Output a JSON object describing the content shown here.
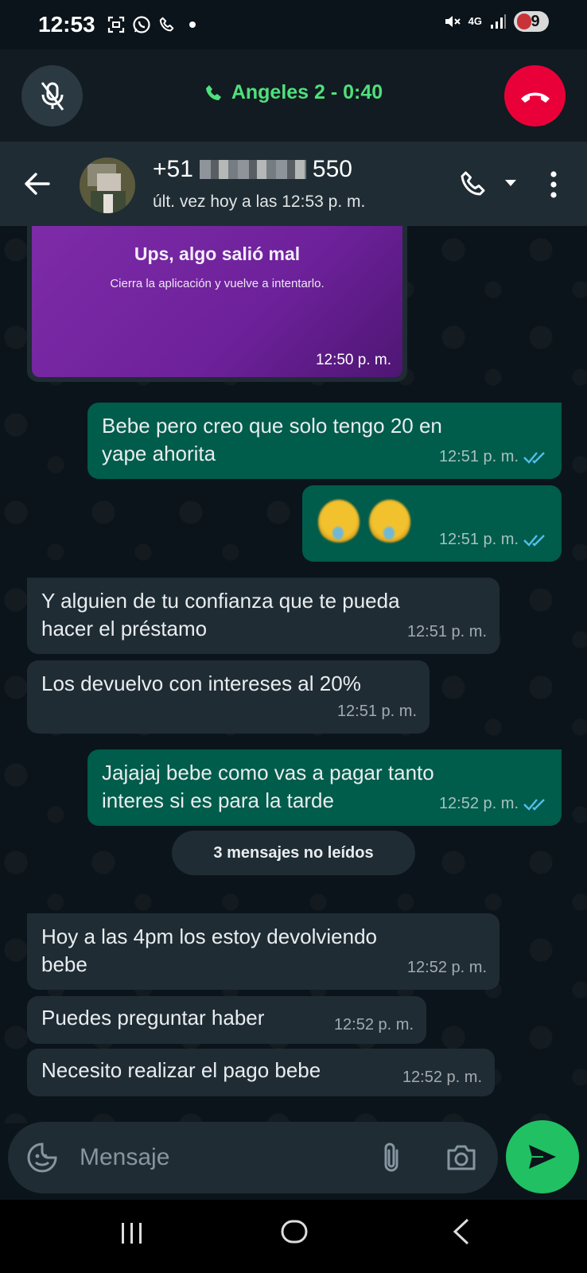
{
  "status_bar": {
    "time": "12:53",
    "network": "4G",
    "battery": "9"
  },
  "call": {
    "label": "Angeles 2 - 0:40"
  },
  "contact": {
    "name_prefix": "+51",
    "name_suffix": "550",
    "status": "últ. vez hoy a las 12:53 p. m."
  },
  "messages": [
    {
      "type": "image",
      "direction": "in",
      "title": "Ups, algo salió mal",
      "subtitle": "Cierra la aplicación y vuelve a intentarlo.",
      "time": "12:50 p. m."
    },
    {
      "type": "text",
      "direction": "out",
      "line1": "Bebe pero creo que solo tengo 20 en",
      "line2": "yape ahorita",
      "time": "12:51 p. m.",
      "read": true
    },
    {
      "type": "emoji",
      "direction": "out",
      "emoji_name": "crying-face-emoji",
      "time": "12:51 p. m.",
      "read": true
    },
    {
      "type": "text",
      "direction": "in",
      "line1": "Y alguien de tu confianza que te pueda",
      "line2": "hacer el préstamo",
      "time": "12:51 p. m."
    },
    {
      "type": "text",
      "direction": "in",
      "line1": "Los devuelvo con intereses al 20%",
      "time": "12:51 p. m."
    },
    {
      "type": "text",
      "direction": "out",
      "line1": "Jajajaj bebe como vas a pagar tanto",
      "line2": "interes si es para la tarde",
      "time": "12:52 p. m.",
      "read": true
    },
    {
      "type": "text",
      "direction": "in",
      "line1": "Hoy a las 4pm  los estoy devolviendo",
      "line2": "bebe",
      "time": "12:52 p. m."
    },
    {
      "type": "text",
      "direction": "in",
      "line1": "Puedes preguntar haber",
      "time": "12:52 p. m."
    },
    {
      "type": "text",
      "direction": "in",
      "line1": "Necesito realizar el pago bebe",
      "time": "12:52 p. m."
    }
  ],
  "unread_divider": "3 mensajes no leídos",
  "composer": {
    "placeholder": "Mensaje"
  },
  "colors": {
    "background": "#0b141a",
    "incoming_bubble": "#1f2c34",
    "outgoing_bubble": "#005c4b",
    "call_green": "#4fe07c",
    "end_call_red": "#ea0038",
    "send_green": "#21c063",
    "read_ticks": "#53bdeb"
  },
  "icons": {
    "status_left": [
      "screenshot-icon",
      "whatsapp-icon",
      "phone-icon",
      "dot-icon"
    ],
    "status_right": [
      "mute-icon",
      "network-icon",
      "signal-icon",
      "battery-icon"
    ],
    "call_banner": [
      "mic-off-icon",
      "phone-icon",
      "end-call-icon"
    ],
    "header": [
      "back-arrow-icon",
      "call-icon",
      "caret-down-icon",
      "more-vert-icon"
    ],
    "composer": [
      "sticker-icon",
      "attach-icon",
      "camera-icon",
      "send-icon"
    ],
    "nav": [
      "recents-icon",
      "home-icon",
      "back-icon"
    ]
  }
}
